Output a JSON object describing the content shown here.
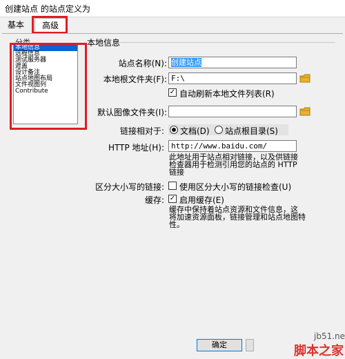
{
  "window": {
    "title": "创建站点 的站点定义为"
  },
  "tabs": [
    {
      "label": "基本",
      "selected": false
    },
    {
      "label": "高级",
      "selected": true
    }
  ],
  "category": {
    "label": "分类",
    "items": [
      {
        "label": "本地信息",
        "selected": true
      },
      {
        "label": "远程信息"
      },
      {
        "label": "测试服务器"
      },
      {
        "label": "遮盖"
      },
      {
        "label": "设计备注"
      },
      {
        "label": "站点地图布局"
      },
      {
        "label": "文件视图列"
      },
      {
        "label": "Contribute"
      }
    ]
  },
  "panel": {
    "title": "本地信息",
    "site_name_label": "站点名称(N):",
    "site_name_value": "创建站点",
    "local_root_label": "本地根文件夹(F):",
    "local_root_value": "F:\\",
    "auto_refresh_label": "自动刷新本地文件列表(R)",
    "auto_refresh_checked": true,
    "default_images_label": "默认图像文件夹(I):",
    "default_images_value": "",
    "links_relative_label": "链接相对于:",
    "radio_document_label": "文档(D)",
    "radio_site_root_label": "站点根目录(S)",
    "http_label": "HTTP 地址(H):",
    "http_value": "http://www.baidu.com/",
    "http_hint": "此地址用于站点相对链接，以及供链接\n检查器用于检测引用您的站点的 HTTP\n链接",
    "case_label": "区分大小写的链接:",
    "case_check_label": "使用区分大小写的链接检查(U)",
    "case_checked": false,
    "cache_label": "缓存:",
    "cache_check_label": "启用缓存(E)",
    "cache_checked": true,
    "cache_hint": "缓存中保持着站点资源和文件信息，这\n将加速资源面板，链接管理和站点地图特\n性。"
  },
  "footer": {
    "ok_label": "确定"
  },
  "watermark": {
    "line1": "jb51.net",
    "line2": "脚本之家"
  },
  "colors": {
    "highlight": "#e01b24",
    "selection": "#0a64d6",
    "folder": "#e8b22a"
  }
}
